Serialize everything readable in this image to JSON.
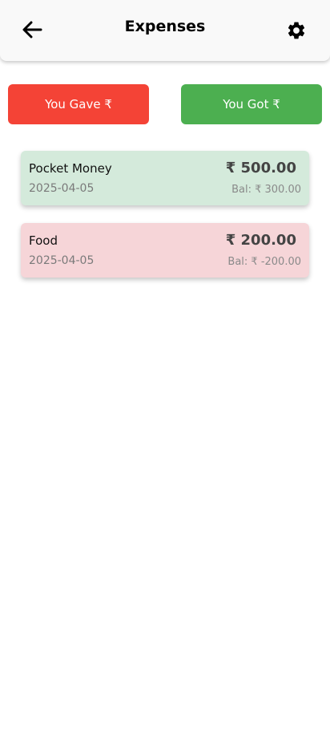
{
  "header": {
    "title": "Expenses",
    "back_icon": "arrow-left-icon",
    "settings_icon": "gear-icon"
  },
  "actions": {
    "gave_label": "You Gave ₹",
    "got_label": "You Got ₹"
  },
  "entries": [
    {
      "name": "Pocket Money",
      "date": "2025-04-05",
      "amount": "₹ 500.00",
      "balance": "Bal: ₹ 300.00",
      "type": "got"
    },
    {
      "name": "Food",
      "date": "2025-04-05",
      "amount": "₹ 200.00",
      "balance": "Bal: ₹ -200.00",
      "type": "gave"
    }
  ],
  "colors": {
    "gave": "#f44336",
    "got": "#4caf50",
    "got_card": "#d4eadb",
    "gave_card": "#f6d5d8"
  }
}
